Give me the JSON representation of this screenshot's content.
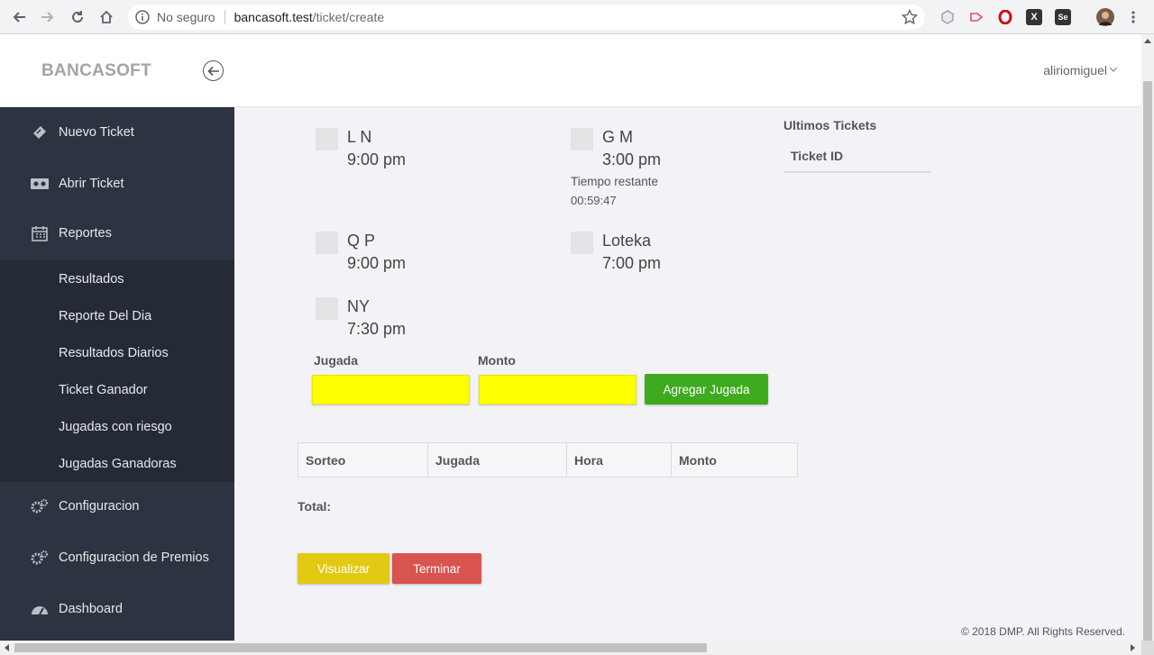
{
  "browser": {
    "security_label": "No seguro",
    "url_host": "bancasoft.test",
    "url_path": "/ticket/create",
    "extensions": [
      {
        "icon": "cube-extension-icon",
        "color": "#9aa0a6"
      },
      {
        "icon": "arrow-extension-icon",
        "color": "#e84a5f"
      },
      {
        "icon": "opera-extension-icon",
        "color": "#cc0f16"
      },
      {
        "icon": "x-extension-icon",
        "color": "#333333"
      },
      {
        "icon": "se-extension-icon",
        "color": "#333333"
      }
    ]
  },
  "header": {
    "brand": "BANCASOFT",
    "user": "aliriomiguel"
  },
  "sidebar": {
    "items": [
      {
        "label": "Nuevo Ticket",
        "icon": "ticket-icon"
      },
      {
        "label": "Abrir Ticket",
        "icon": "open-ticket-icon"
      },
      {
        "label": "Reportes",
        "icon": "calendar-icon"
      },
      {
        "label": "Configuracion",
        "icon": "cogs-icon"
      },
      {
        "label": "Configuracion de Premios",
        "icon": "cogs-icon"
      },
      {
        "label": "Dashboard",
        "icon": "dashboard-icon"
      }
    ],
    "submenu": [
      "Resultados",
      "Reporte Del Dia",
      "Resultados Diarios",
      "Ticket Ganador",
      "Jugadas con riesgo",
      "Jugadas Ganadoras"
    ]
  },
  "draws": [
    {
      "name": "L N",
      "time": "9:00 pm"
    },
    {
      "name": "G M",
      "time": "3:00 pm",
      "remaining_label": "Tiempo restante",
      "remaining_value": "00:59:47"
    },
    {
      "name": "Q P",
      "time": "9:00 pm"
    },
    {
      "name": "Loteka",
      "time": "7:00 pm"
    },
    {
      "name": "NY",
      "time": "7:30 pm"
    }
  ],
  "form": {
    "jugada_label": "Jugada",
    "monto_label": "Monto",
    "add_button": "Agregar Jugada",
    "colors": {
      "input": "#ffff00",
      "add": "#3dab1d",
      "view": "#e3c912",
      "finish": "#d9534f"
    }
  },
  "table": {
    "columns": [
      "Sorteo",
      "Jugada",
      "Hora",
      "Monto"
    ]
  },
  "total_label": "Total:",
  "actions": {
    "view": "Visualizar",
    "finish": "Terminar"
  },
  "recent": {
    "title": "Ultimos Tickets",
    "column": "Ticket ID"
  },
  "footer": "© 2018 DMP. All Rights Reserved."
}
